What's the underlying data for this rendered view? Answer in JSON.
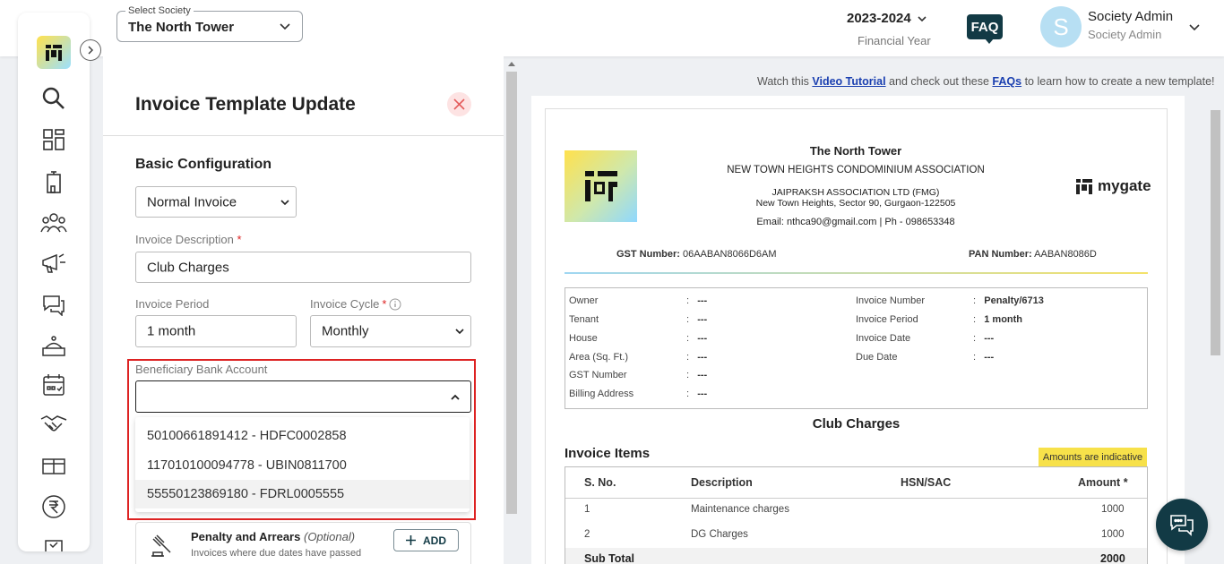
{
  "header": {
    "society_label": "Select Society",
    "society_value": "The North Tower",
    "financial_year": "2023-2024",
    "financial_year_label": "Financial Year",
    "faq": "FAQ",
    "avatar_letter": "S",
    "user_name": "Society Admin",
    "user_role": "Society Admin"
  },
  "sidebar": {
    "items": [
      "search-icon",
      "dashboard-icon",
      "building-icon",
      "residents-icon",
      "announcement-icon",
      "chat-icon",
      "amenity-icon",
      "calendar-icon",
      "handshake-icon",
      "package-icon",
      "rupee-icon",
      "checklist-icon"
    ]
  },
  "form": {
    "title": "Invoice Template Update",
    "section": "Basic Configuration",
    "invoice_type": "Normal Invoice",
    "description_label": "Invoice Description",
    "description_value": "Club Charges",
    "period_label": "Invoice Period",
    "period_value": "1 month",
    "cycle_label": "Invoice Cycle",
    "cycle_value": "Monthly",
    "bank_label": "Beneficiary Bank Account",
    "bank_options": [
      "50100661891412 - HDFC0002858",
      "117010100094778 - UBIN0811700",
      "55550123869180 - FDRL0005555"
    ],
    "penalty_title": "Penalty and Arrears",
    "penalty_optional": "(Optional)",
    "penalty_desc": "Invoices where due dates have passed",
    "add_label": "ADD"
  },
  "hint": {
    "pre": "Watch this",
    "video_link": "Video Tutorial",
    "mid": "and check out these",
    "faq_link": "FAQs",
    "post": "to learn how to create a new template!"
  },
  "preview": {
    "society_name": "The North Tower",
    "association": "NEW TOWN HEIGHTS CONDOMINIUM ASSOCIATION",
    "company": "JAIPRAKSH ASSOCIATION LTD (FMG)",
    "address": "New Town Heights, Sector 90, Gurgaon-122505",
    "contact": "Email: nthca90@gmail.com | Ph - 098653348",
    "brand": "mygate",
    "gst_label": "GST Number:",
    "gst_value": "06AABAN8066D6AM",
    "pan_label": "PAN Number:",
    "pan_value": "AABAN8086D",
    "left_fields": [
      {
        "label": "Owner",
        "value": "---"
      },
      {
        "label": "Tenant",
        "value": "---"
      },
      {
        "label": "House",
        "value": "---"
      },
      {
        "label": "Area (Sq. Ft.)",
        "value": "---"
      },
      {
        "label": "GST Number",
        "value": "---"
      },
      {
        "label": "Billing Address",
        "value": "---"
      }
    ],
    "right_fields": [
      {
        "label": "Invoice Number",
        "value": "Penalty/6713"
      },
      {
        "label": "Invoice Period",
        "value": "1 month"
      },
      {
        "label": "Invoice Date",
        "value": "---"
      },
      {
        "label": "Due Date",
        "value": "---"
      }
    ],
    "invoice_title": "Club Charges",
    "items_title": "Invoice Items",
    "indicative": "Amounts are indicative",
    "columns": [
      "S. No.",
      "Description",
      "HSN/SAC",
      "Amount"
    ],
    "rows": [
      {
        "sno": "1",
        "desc": "Maintenance charges",
        "amount": "1000"
      },
      {
        "sno": "2",
        "desc": "DG Charges",
        "amount": "1000"
      }
    ],
    "subtotal_label": "Sub Total",
    "subtotal_value": "2000"
  },
  "colors": {
    "brand_dark": "#123a45",
    "highlight_red": "#dd2222",
    "indicative_yellow": "#f7e14a"
  }
}
